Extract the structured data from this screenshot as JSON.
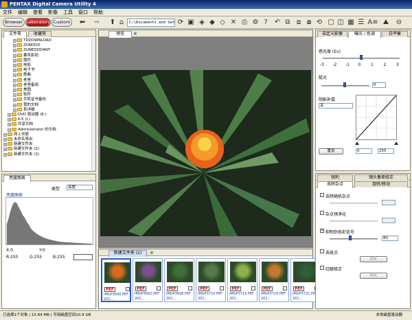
{
  "app": {
    "title": "PENTAX Digital Camera Utility 4",
    "menu": [
      "文件",
      "编辑",
      "查看",
      "影像",
      "工具",
      "窗口",
      "帮助"
    ]
  },
  "toolbar": {
    "modes": [
      "Browser",
      "Laboratory",
      "Custom"
    ],
    "active_mode": "Laboratory",
    "path": "C:\\Documents and Sett"
  },
  "left_panel": {
    "tabs": [
      "文件夹",
      "收藏夹"
    ],
    "tree": [
      "TDDOWNLOAD",
      "ZUNDDD",
      "ZUNEDDDANT",
      "暴风影码",
      "插件",
      "电影",
      "电子书",
      "歌曲",
      "老爸",
      "老爸备用",
      "美图",
      "软件",
      "手机证书备份",
      "我的文档",
      "系详细",
      "DVD 驱动器 (E:)",
      "K-5 (I:)",
      "共享文档",
      "Administrator 的文档",
      "网上邻居",
      "未命名导出",
      "新建文件夹",
      "新建文件夹 (2)",
      "新建文件夹 (3)"
    ]
  },
  "histogram_panel": {
    "tab": "亮度图表",
    "type_label": "类型",
    "type_value": "亮度",
    "series_label": "亮度图表",
    "x_label": "X:0",
    "y_label": "Y:0",
    "r": "R:255",
    "g": "G:255",
    "b": "B:255"
  },
  "preview": {
    "tab": "预览"
  },
  "filmstrip": {
    "tab": "新建文件夹 (2)",
    "items": [
      {
        "type": "PEF",
        "name": "IMGP3690.PEF",
        "date": "201..."
      },
      {
        "type": "PEF",
        "name": "IMGP3692.PEF",
        "date": "201..."
      },
      {
        "type": "PEF",
        "name": "IMGP3696.PEF",
        "date": "201..."
      },
      {
        "type": "PEF",
        "name": "IMGP3710.PEF",
        "date": "201..."
      },
      {
        "type": "PEF",
        "name": "IMGP3715.PEF",
        "date": "201..."
      },
      {
        "type": "PEF",
        "name": "IMGP3720.PEF",
        "date": "201..."
      },
      {
        "type": "PEF",
        "name": "IMGP3721.PEF",
        "date": "201..."
      }
    ]
  },
  "right_top": {
    "tabs": [
      "自定义影像",
      "曝光 / 色调",
      "白平衡"
    ],
    "exposure_label": "感光度 (Ev)",
    "scale": [
      "-3",
      "-2",
      "-1",
      "0",
      "1",
      "2",
      "3"
    ],
    "contrast_label": "陡光",
    "contrast_value": "0",
    "curve_label": "阴影补偿",
    "curve_value": "关",
    "reset_label": "重设",
    "level_low": "0",
    "level_high": "255"
  },
  "right_bottom": {
    "tabs_row1": [
      "锐利",
      "镜头像差校正"
    ],
    "tabs_row2": [
      "去除杂点",
      "旋转/移动"
    ],
    "options": [
      "去除随机杂点",
      "杂点预净化",
      "抑制伪色彩信号",
      "去斑点",
      "红眼修正"
    ],
    "false_color_value": "80",
    "setting_label": "设定"
  },
  "status": {
    "left": "已选择1个对象 | 15.84 MB | 可用磁盘空间10.9 GB",
    "right": "本地磁盘驱动器"
  },
  "colors": {
    "title_bar": "#0a246a",
    "active_mode": "#c62020",
    "accent": "#3c5fa8"
  }
}
